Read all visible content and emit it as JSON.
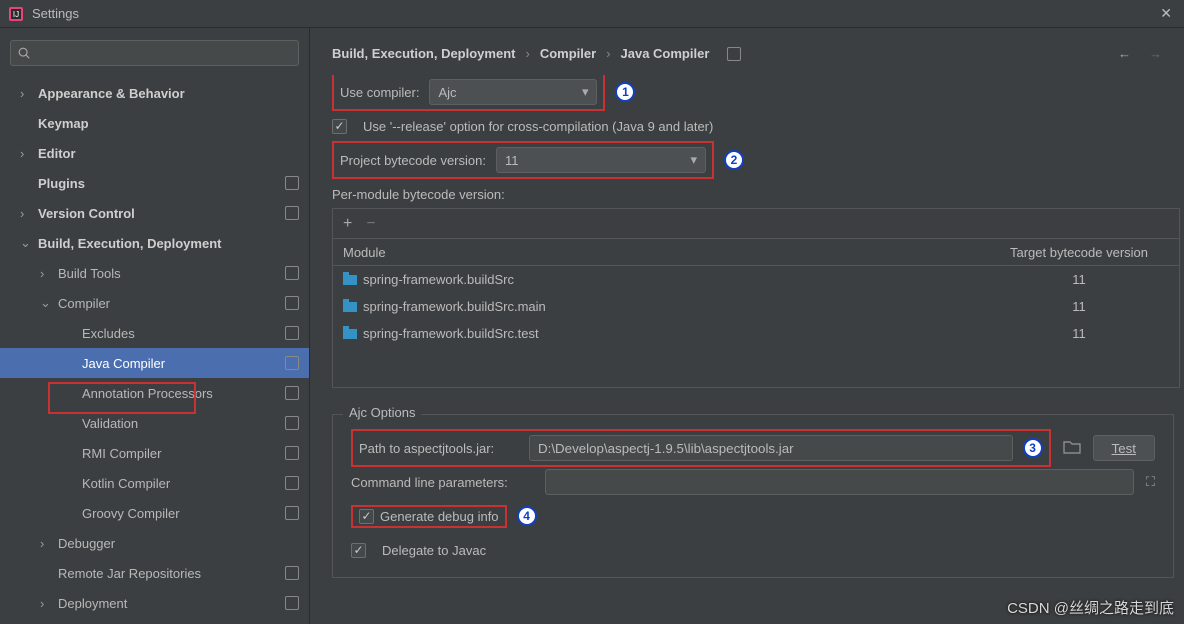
{
  "window": {
    "title": "Settings"
  },
  "search": {
    "placeholder": ""
  },
  "tree": {
    "appearance": "Appearance & Behavior",
    "keymap": "Keymap",
    "editor": "Editor",
    "plugins": "Plugins",
    "vcs": "Version Control",
    "bed": "Build, Execution, Deployment",
    "buildtools": "Build Tools",
    "compiler": "Compiler",
    "excludes": "Excludes",
    "javacompiler": "Java Compiler",
    "annotation": "Annotation Processors",
    "validation": "Validation",
    "rmi": "RMI Compiler",
    "kotlin": "Kotlin Compiler",
    "groovy": "Groovy Compiler",
    "debugger": "Debugger",
    "remotejar": "Remote Jar Repositories",
    "deployment": "Deployment"
  },
  "breadcrumb": {
    "a": "Build, Execution, Deployment",
    "b": "Compiler",
    "c": "Java Compiler"
  },
  "form": {
    "usecompiler_label": "Use compiler:",
    "usecompiler_value": "Ajc",
    "release_label": "Use '--release' option for cross-compilation (Java 9 and later)",
    "bytecode_label": "Project bytecode version:",
    "bytecode_value": "11",
    "permodule_label": "Per-module bytecode version:",
    "table": {
      "col_module": "Module",
      "col_target": "Target bytecode version",
      "rows": [
        {
          "module": "spring-framework.buildSrc",
          "target": "11"
        },
        {
          "module": "spring-framework.buildSrc.main",
          "target": "11"
        },
        {
          "module": "spring-framework.buildSrc.test",
          "target": "11"
        }
      ]
    },
    "ajc_legend": "Ajc Options",
    "path_label": "Path to aspectjtools.jar:",
    "path_value": "D:\\Develop\\aspectj-1.9.5\\lib\\aspectjtools.jar",
    "test_button": "Test",
    "cmdline_label": "Command line parameters:",
    "cmdline_value": "",
    "debug_label": "Generate debug info",
    "delegate_label": "Delegate to Javac"
  },
  "callouts": {
    "c1": "1",
    "c2": "2",
    "c3": "3",
    "c4": "4"
  },
  "watermark": "CSDN @丝绸之路走到底"
}
